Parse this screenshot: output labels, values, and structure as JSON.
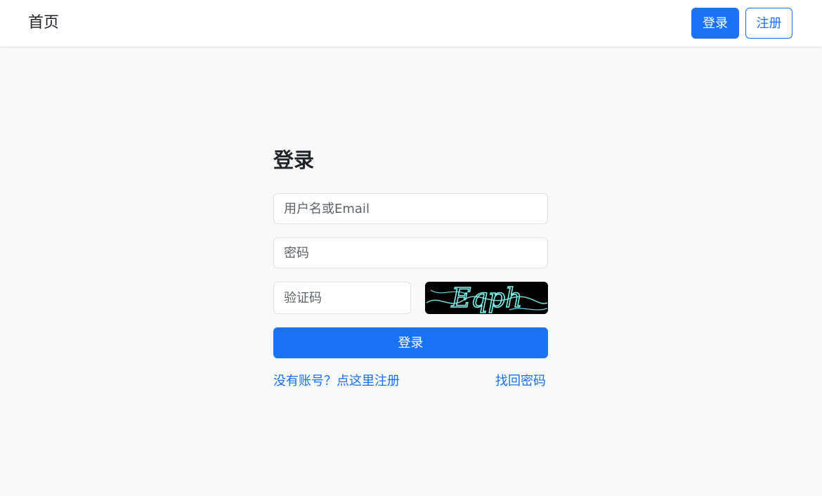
{
  "navbar": {
    "brand": "首页",
    "login_label": "登录",
    "register_label": "注册"
  },
  "form": {
    "title": "登录",
    "username_placeholder": "用户名或Email",
    "password_placeholder": "密码",
    "captcha_placeholder": "验证码",
    "captcha_text": "Eqph",
    "submit_label": "登录",
    "register_link": "没有账号？点这里注册",
    "forgot_link": "找回密码"
  },
  "colors": {
    "primary": "#1a73f5",
    "background": "#f8f9fa",
    "captcha_bg": "#000000",
    "captcha_fg": "#7ff0e8"
  }
}
